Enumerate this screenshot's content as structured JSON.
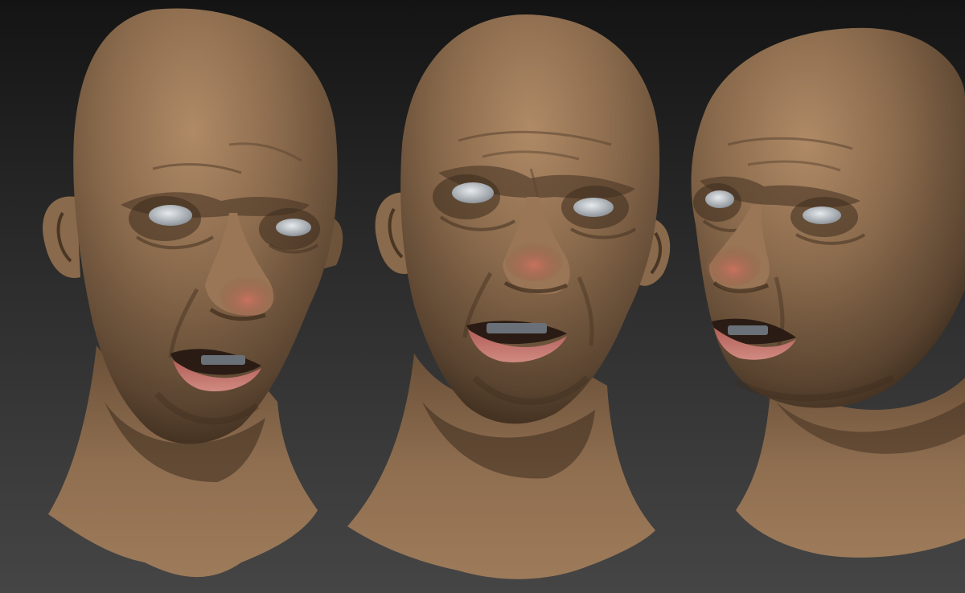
{
  "scene": {
    "subject": "three-views-sculpted-head",
    "views": [
      {
        "id": "view-1"
      },
      {
        "id": "view-2"
      },
      {
        "id": "view-3"
      }
    ],
    "colors": {
      "skin": "#8a6a4c",
      "skin_highlight": "#b08a66",
      "skin_shadow": "#3d2c1d",
      "lips": "#c2706a",
      "nose_tip": "#c4705e",
      "eyes": "#c9ced4",
      "teeth": "#6a7078",
      "background_top": "#141414",
      "background_bottom": "#454545"
    }
  }
}
